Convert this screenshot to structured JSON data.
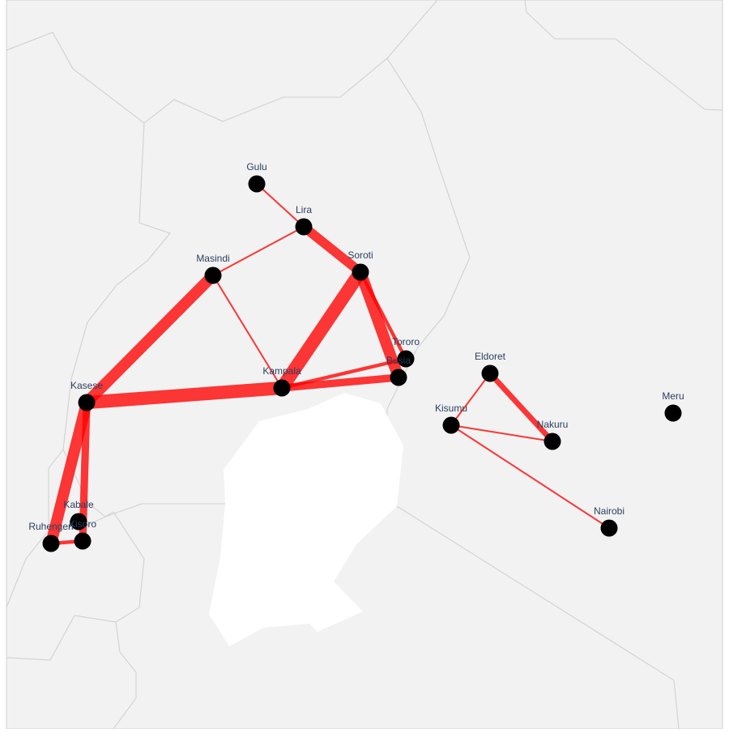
{
  "map": {
    "colors": {
      "land": "#f2f2f2",
      "border": "#d0d0d0",
      "water": "#ffffff",
      "route": "#ff0000",
      "marker": "#000000",
      "label": "#2a3f5f"
    },
    "cities": [
      {
        "id": "gulu",
        "name": "Gulu"
      },
      {
        "id": "lira",
        "name": "Lira"
      },
      {
        "id": "masindi",
        "name": "Masindi"
      },
      {
        "id": "soroti",
        "name": "Soroti"
      },
      {
        "id": "tororo",
        "name": "Tororo"
      },
      {
        "id": "busia",
        "name": "Busia"
      },
      {
        "id": "kampala",
        "name": "Kampala"
      },
      {
        "id": "kasese",
        "name": "Kasese"
      },
      {
        "id": "kabale",
        "name": "Kabale"
      },
      {
        "id": "ruhengeri",
        "name": "Ruhengeri"
      },
      {
        "id": "kisoro",
        "name": "Kisoro"
      },
      {
        "id": "eldoret",
        "name": "Eldoret"
      },
      {
        "id": "kisumu",
        "name": "Kisumu"
      },
      {
        "id": "nakuru",
        "name": "Nakuru"
      },
      {
        "id": "nairobi",
        "name": "Nairobi"
      },
      {
        "id": "meru",
        "name": "Meru"
      }
    ],
    "routes": [
      {
        "from": "gulu",
        "to": "lira",
        "weight": 1
      },
      {
        "from": "lira",
        "to": "masindi",
        "weight": 1
      },
      {
        "from": "lira",
        "to": "soroti",
        "weight": 5
      },
      {
        "from": "masindi",
        "to": "kampala",
        "weight": 1
      },
      {
        "from": "masindi",
        "to": "kasese",
        "weight": 6
      },
      {
        "from": "soroti",
        "to": "kampala",
        "weight": 7
      },
      {
        "from": "soroti",
        "to": "busia",
        "weight": 6
      },
      {
        "from": "soroti",
        "to": "tororo",
        "weight": 2
      },
      {
        "from": "kampala",
        "to": "busia",
        "weight": 4
      },
      {
        "from": "kampala",
        "to": "tororo",
        "weight": 2
      },
      {
        "from": "kasese",
        "to": "kampala",
        "weight": 7
      },
      {
        "from": "kasese",
        "to": "ruhengeri",
        "weight": 6
      },
      {
        "from": "kasese",
        "to": "kisoro",
        "weight": 4
      },
      {
        "from": "ruhengeri",
        "to": "kisoro",
        "weight": 2
      },
      {
        "from": "eldoret",
        "to": "kisumu",
        "weight": 1
      },
      {
        "from": "eldoret",
        "to": "nakuru",
        "weight": 3
      },
      {
        "from": "kisumu",
        "to": "nakuru",
        "weight": 1
      },
      {
        "from": "kisumu",
        "to": "nairobi",
        "weight": 1
      }
    ]
  }
}
